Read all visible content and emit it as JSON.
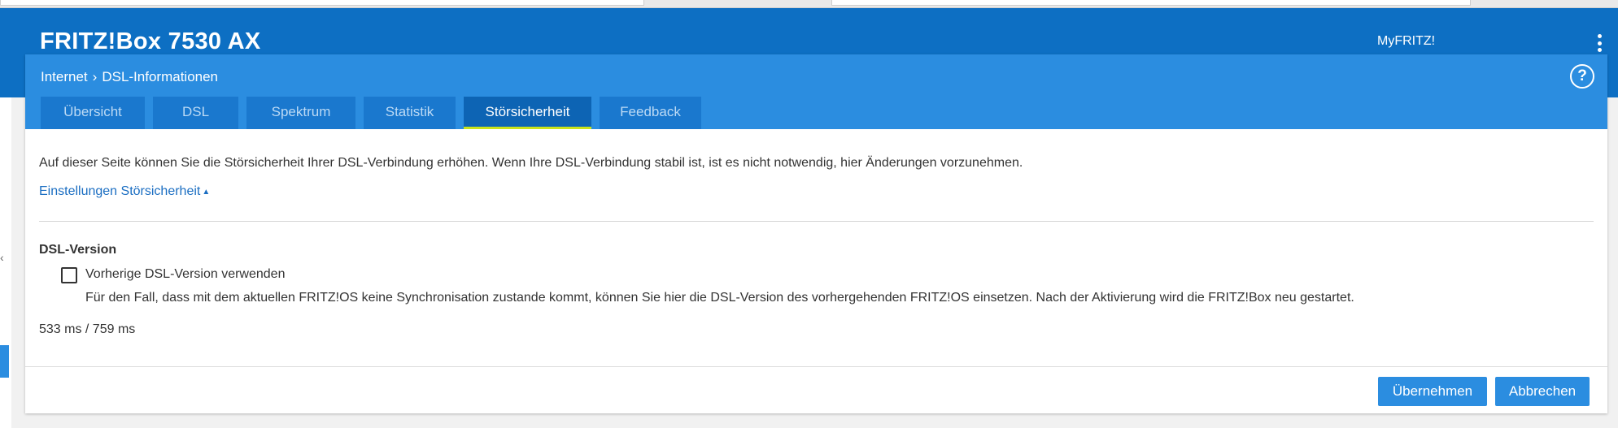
{
  "header": {
    "product_title": "FRITZ!Box 7530 AX",
    "myfritz_label": "MyFRITZ!",
    "menu_icon": "kebab-menu-icon"
  },
  "breadcrumb": {
    "parent": "Internet",
    "separator_icon": "chevron-right-icon",
    "current": "DSL-Informationen"
  },
  "help": {
    "label": "?",
    "icon": "help-icon"
  },
  "tabs": [
    {
      "label": "Übersicht",
      "active": false
    },
    {
      "label": "DSL",
      "active": false
    },
    {
      "label": "Spektrum",
      "active": false
    },
    {
      "label": "Statistik",
      "active": false
    },
    {
      "label": "Störsicherheit",
      "active": true
    },
    {
      "label": "Feedback",
      "active": false
    }
  ],
  "content": {
    "intro": "Auf dieser Seite können Sie die Störsicherheit Ihrer DSL-Verbindung erhöhen. Wenn Ihre DSL-Verbindung stabil ist, ist es nicht notwendig, hier Änderungen vorzunehmen.",
    "settings_toggle": "Einstellungen Störsicherheit",
    "section_title": "DSL-Version",
    "checkbox": {
      "label": "Vorherige DSL-Version verwenden",
      "checked": false,
      "description": "Für den Fall, dass mit dem aktuellen FRITZ!OS keine Synchronisation zustande kommt, können Sie hier die DSL-Version des vorhergehenden FRITZ!OS einsetzen. Nach der Aktivierung wird die FRITZ!Box neu gestartet."
    },
    "timing": "533 ms / 759 ms"
  },
  "actions": {
    "apply_label": "Übernehmen",
    "cancel_label": "Abbrechen"
  },
  "colors": {
    "topbar": "#0d6fc3",
    "panel_header": "#2b8de0",
    "tab_inactive": "#1a78ce",
    "tab_active": "#0d64b4",
    "tab_active_underline": "#c9e31a",
    "link": "#1b6ec2",
    "button": "#2b8de0"
  }
}
